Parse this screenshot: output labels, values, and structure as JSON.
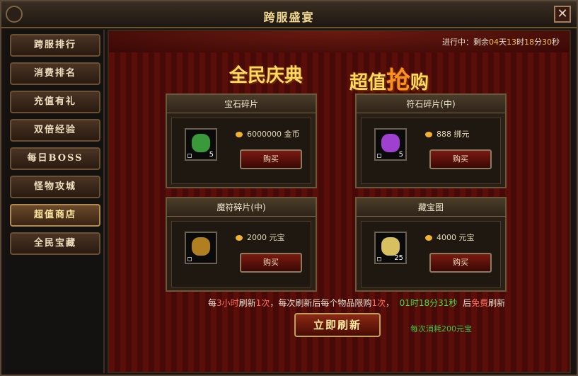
{
  "window": {
    "title": "跨服盛宴",
    "close": "✕"
  },
  "sidebar": {
    "items": [
      {
        "label": "跨服排行"
      },
      {
        "label": "消费排名"
      },
      {
        "label": "充值有礼"
      },
      {
        "label": "双倍经验"
      },
      {
        "label": "每日BOSS"
      },
      {
        "label": "怪物攻城"
      },
      {
        "label": "超值商店"
      },
      {
        "label": "全民宝藏"
      }
    ],
    "active_index": 6
  },
  "timer": {
    "prefix": "进行中：剩余",
    "days": "04",
    "d_unit": "天",
    "hours": "13",
    "h_unit": "时",
    "minutes": "18",
    "m_unit": "分",
    "seconds": "30",
    "s_unit": "秒"
  },
  "banner": {
    "part1": "全民庆典",
    "part2": "超值",
    "part3": "抢",
    "part4": "购"
  },
  "shop": {
    "items": [
      {
        "name": "宝石碎片",
        "price": "6000000",
        "currency": "金币",
        "count": "5",
        "buy_label": "购买",
        "icon": "green-gem-icon",
        "icon_color": "#3a9a3a"
      },
      {
        "name": "符石碎片(中)",
        "price": "888",
        "currency": "绑元",
        "count": "5",
        "buy_label": "购买",
        "icon": "purple-crystal-icon",
        "icon_color": "#a040d0"
      },
      {
        "name": "魔符碎片(中)",
        "price": "2000",
        "currency": "元宝",
        "count": "",
        "buy_label": "购买",
        "icon": "rune-icon",
        "icon_color": "#b08020"
      },
      {
        "name": "藏宝图",
        "price": "4000",
        "currency": "元宝",
        "count": "25",
        "buy_label": "购买",
        "icon": "treasure-map-icon",
        "icon_color": "#d8c060"
      }
    ]
  },
  "note": {
    "t1": "每",
    "t2": "3小时",
    "t3": "刷新",
    "t4": "1次",
    "t5": "，每次刷新后每个物品限购",
    "t6": "1次",
    "t7": "，",
    "t8": "01时18分31秒",
    "t9": "后",
    "t10": "免费",
    "t11": "刷新"
  },
  "refresh": {
    "label": "立即刷新",
    "cost": "每次消耗200元宝"
  }
}
